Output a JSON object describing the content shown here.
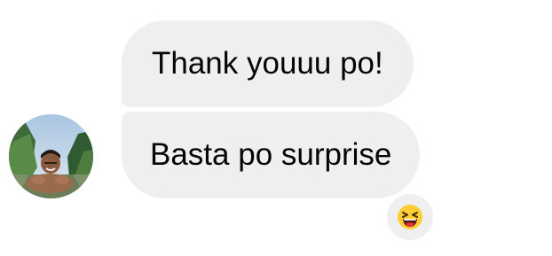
{
  "messages": [
    {
      "text": "Thank youuu po!"
    },
    {
      "text": "Basta po surprise"
    }
  ],
  "sender": {
    "avatar": "avatar-photo"
  },
  "reaction": {
    "emoji": "laughing-face-icon"
  },
  "colors": {
    "bubble": "#efefef",
    "text": "#050505",
    "emoji_face": "#ffcc33",
    "emoji_mouth": "#e8313c"
  }
}
